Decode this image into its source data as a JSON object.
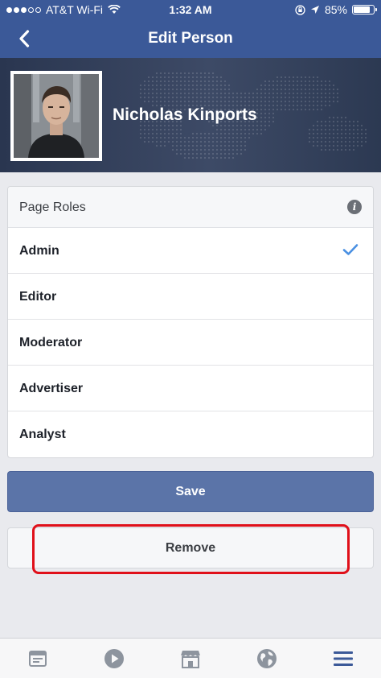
{
  "status_bar": {
    "carrier": "AT&T Wi-Fi",
    "time": "1:32 AM",
    "battery": "85%",
    "battery_level": 0.85
  },
  "nav": {
    "title": "Edit Person",
    "back_icon": "chevron-left-icon"
  },
  "profile": {
    "name": "Nicholas Kinports"
  },
  "roles": {
    "header": "Page Roles",
    "items": [
      {
        "label": "Admin",
        "selected": true
      },
      {
        "label": "Editor",
        "selected": false
      },
      {
        "label": "Moderator",
        "selected": false
      },
      {
        "label": "Advertiser",
        "selected": false
      },
      {
        "label": "Analyst",
        "selected": false
      }
    ]
  },
  "actions": {
    "save_label": "Save",
    "remove_label": "Remove"
  },
  "tab_bar": {
    "items": [
      "news-feed-icon",
      "video-icon",
      "marketplace-icon",
      "notifications-globe-icon",
      "menu-icon"
    ],
    "active": "menu-icon"
  },
  "colors": {
    "brand_blue": "#3b5998",
    "save_button": "#5b74a8",
    "check_blue": "#4a90e2",
    "highlight_red": "#e0101a"
  }
}
